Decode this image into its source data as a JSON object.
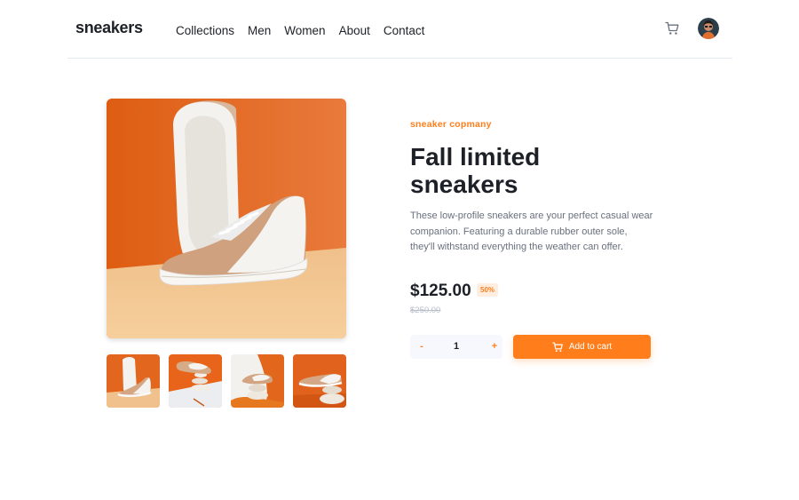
{
  "header": {
    "logo": "sneakers",
    "nav": [
      {
        "label": "Collections"
      },
      {
        "label": "Men"
      },
      {
        "label": "Women"
      },
      {
        "label": "About"
      },
      {
        "label": "Contact"
      }
    ],
    "cart_icon": "cart-icon",
    "avatar_icon": "user-avatar"
  },
  "gallery": {
    "main_image": "white-tan-sneaker-on-orange-background",
    "thumbnails": [
      "sneaker-thumbnail-1",
      "sneaker-thumbnail-2",
      "sneaker-thumbnail-3",
      "sneaker-thumbnail-4"
    ]
  },
  "product": {
    "company": "sneaker copmany",
    "title": "Fall limited sneakers",
    "description": "These low-profile sneakers are your perfect casual wear companion. Featuring a durable rubber outer sole, they'll withstand everything the weather can offer.",
    "price": "$125.00",
    "discount": "50%",
    "old_price": "$250.00"
  },
  "cart_controls": {
    "minus": "-",
    "quantity": "1",
    "plus": "+",
    "add_label": "Add to cart"
  },
  "colors": {
    "accent": "#ff7e1b",
    "accent_light": "#ffede0",
    "text_dark": "#1d2026",
    "text_gray": "#69707d",
    "stepper_bg": "#f6f8fd"
  }
}
